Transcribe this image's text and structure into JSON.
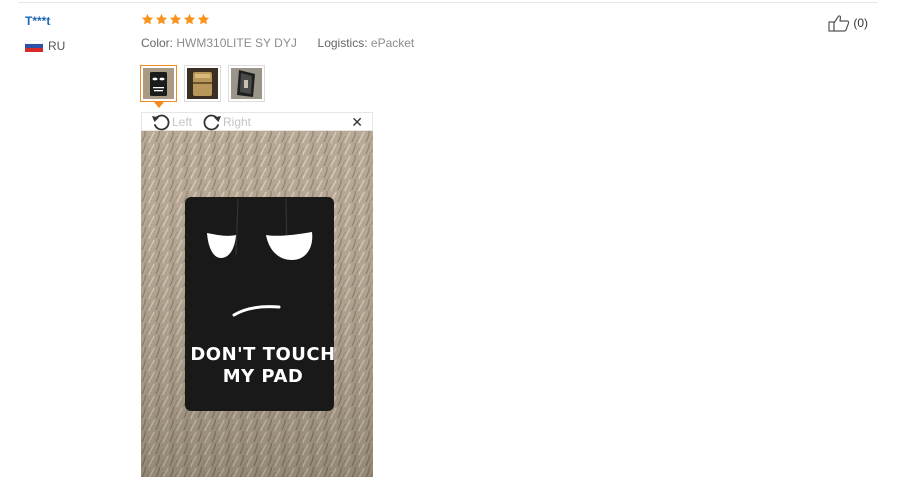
{
  "reviewer": {
    "name": "T***t",
    "country": "RU"
  },
  "rating": {
    "stars": 5,
    "max": 5
  },
  "order_info": {
    "color_label": "Color:",
    "color_value": "HWM310LITE SY DYJ",
    "logistics_label": "Logistics:",
    "logistics_value": "ePacket"
  },
  "helpful": {
    "count": "(0)",
    "icon": "thumbs-up-icon"
  },
  "thumbnails": [
    {
      "name": "review-photo-1",
      "active": true
    },
    {
      "name": "review-photo-2",
      "active": false
    },
    {
      "name": "review-photo-3",
      "active": false
    }
  ],
  "viewer": {
    "rotate_left_label": "Left",
    "rotate_right_label": "Right",
    "close_icon": "close-icon"
  },
  "photo": {
    "line1": "DON'T TOUCH",
    "line2": "MY PAD"
  },
  "colors": {
    "link": "#1a66b5",
    "star": "#f7931e",
    "active_border": "#f28a1e"
  }
}
